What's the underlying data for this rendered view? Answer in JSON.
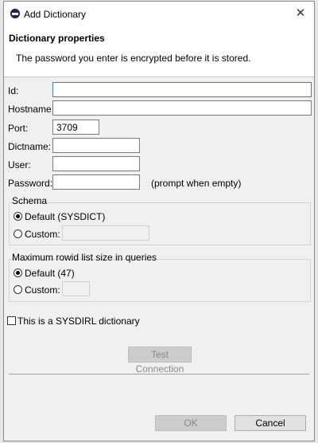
{
  "window": {
    "title": "Add Dictionary",
    "close_glyph": "✕"
  },
  "header": {
    "title": "Dictionary properties",
    "description": "The password you enter is encrypted before it is stored."
  },
  "form": {
    "id": {
      "label": "Id:",
      "value": ""
    },
    "hostname": {
      "label": "Hostname:",
      "value": ""
    },
    "port": {
      "label": "Port:",
      "value": "3709"
    },
    "dictname": {
      "label": "Dictname:",
      "value": ""
    },
    "user": {
      "label": "User:",
      "value": ""
    },
    "password": {
      "label": "Password:",
      "value": "",
      "hint": "(prompt when empty)"
    }
  },
  "schema": {
    "title": "Schema",
    "default_label": "Default (SYSDICT)",
    "custom_label": "Custom:",
    "selected": "default"
  },
  "rowid": {
    "title": "Maximum rowid list size in queries",
    "default_label": "Default (47)",
    "custom_label": "Custom:",
    "selected": "default"
  },
  "sysdirl_checkbox": {
    "label": "This is a SYSDIRL dictionary",
    "checked": false
  },
  "buttons": {
    "test_connection": "Test Connection",
    "ok": "OK",
    "cancel": "Cancel"
  },
  "icons": {
    "app": "eclipse-icon",
    "close": "close-icon"
  }
}
